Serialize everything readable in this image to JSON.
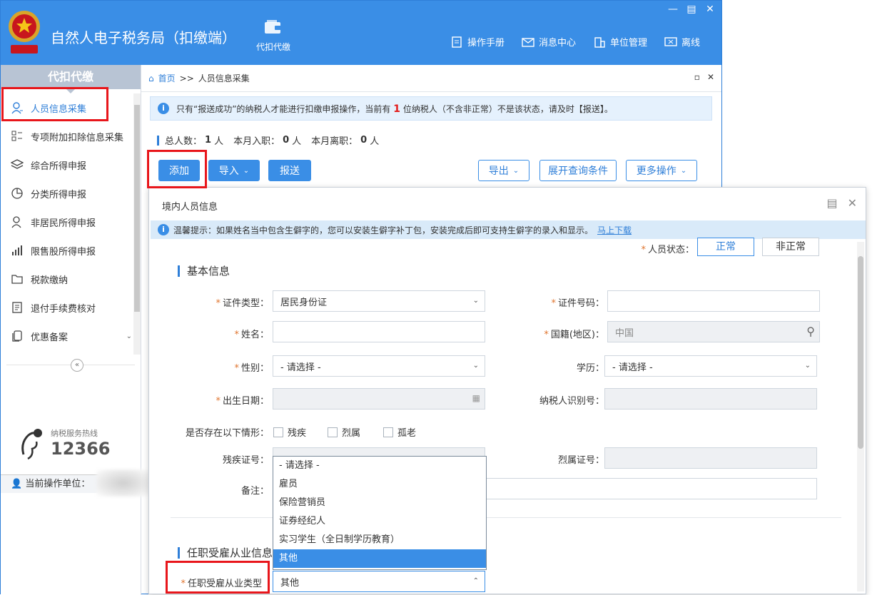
{
  "window": {
    "app_title": "自然人电子税务局（扣缴端）",
    "nav_module": "代扣代缴",
    "win_min": "—",
    "win_max": "▤",
    "win_close": "✕",
    "links": [
      "操作手册",
      "消息中心",
      "单位管理",
      "离线"
    ]
  },
  "sidebar": {
    "header": "代扣代缴",
    "items": [
      {
        "label": "人员信息采集",
        "icon": "person-icon"
      },
      {
        "label": "专项附加扣除信息采集",
        "icon": "list-icon"
      },
      {
        "label": "综合所得申报",
        "icon": "layers-icon"
      },
      {
        "label": "分类所得申报",
        "icon": "pie-icon"
      },
      {
        "label": "非居民所得申报",
        "icon": "person-outline-icon"
      },
      {
        "label": "限售股所得申报",
        "icon": "bar-chart-icon"
      },
      {
        "label": "税款缴纳",
        "icon": "folder-icon"
      },
      {
        "label": "退付手续费核对",
        "icon": "doc-list-icon"
      },
      {
        "label": "优惠备案",
        "icon": "copy-icon"
      }
    ],
    "collapse": "«",
    "hotline_label": "纳税服务热线",
    "hotline_number": "12366",
    "current_unit_label": "当前操作单位："
  },
  "breadcrumb": {
    "home": "首页",
    "sep": ">>",
    "current": "人员信息采集",
    "ctl_restore": "▫",
    "ctl_close": "✕"
  },
  "notice": {
    "icon": "i",
    "prefix": "只有“报送成功”的纳税人才能进行扣缴申报操作，当前有",
    "count": "1",
    "suffix": "位纳税人（不含非正常）不是该状态，请及时【报送】。"
  },
  "stats": {
    "total_label": "总人数：",
    "total_value": "1",
    "total_unit": "人",
    "hire_label": "本月入职：",
    "hire_value": "0",
    "hire_unit": "人",
    "leave_label": "本月离职：",
    "leave_value": "0",
    "leave_unit": "人"
  },
  "toolbar": {
    "add": "添加",
    "import": "导入",
    "report": "报送",
    "export": "导出",
    "expand_query": "展开查询条件",
    "more": "更多操作"
  },
  "modal": {
    "title": "境内人员信息",
    "tip": "温馨提示：如果姓名当中包含生僻字的，您可以安装生僻字补丁包，安装完成后即可支持生僻字的录入和显示。",
    "tip_link": "马上下载",
    "status_label": "人员状态：",
    "status_normal": "正常",
    "status_abnormal": "非正常",
    "section_basic": "基本信息",
    "fields": {
      "id_type_label": "证件类型：",
      "id_type_value": "居民身份证",
      "id_no_label": "证件号码：",
      "name_label": "姓名：",
      "nationality_label": "国籍(地区)：",
      "nationality_value": "中国",
      "gender_label": "性别：",
      "gender_value": "- 请选择 -",
      "education_label": "学历：",
      "education_value": "- 请选择 -",
      "birth_label": "出生日期：",
      "taxpayer_id_label": "纳税人识别号：",
      "situation_label": "是否存在以下情形：",
      "situation_options": [
        "残疾",
        "烈属",
        "孤老"
      ],
      "disability_no_label": "残疾证号：",
      "martyr_no_label": "烈属证号：",
      "remark_label": "备注："
    },
    "section_employment": "任职受雇从业信息",
    "employment_type_label": "任职受雇从业类型",
    "employment_type_value": "其他",
    "employment_options": [
      "- 请选择 -",
      "雇员",
      "保险营销员",
      "证券经纪人",
      "实习学生（全日制学历教育）",
      "其他"
    ],
    "selected_option_index": 5
  }
}
